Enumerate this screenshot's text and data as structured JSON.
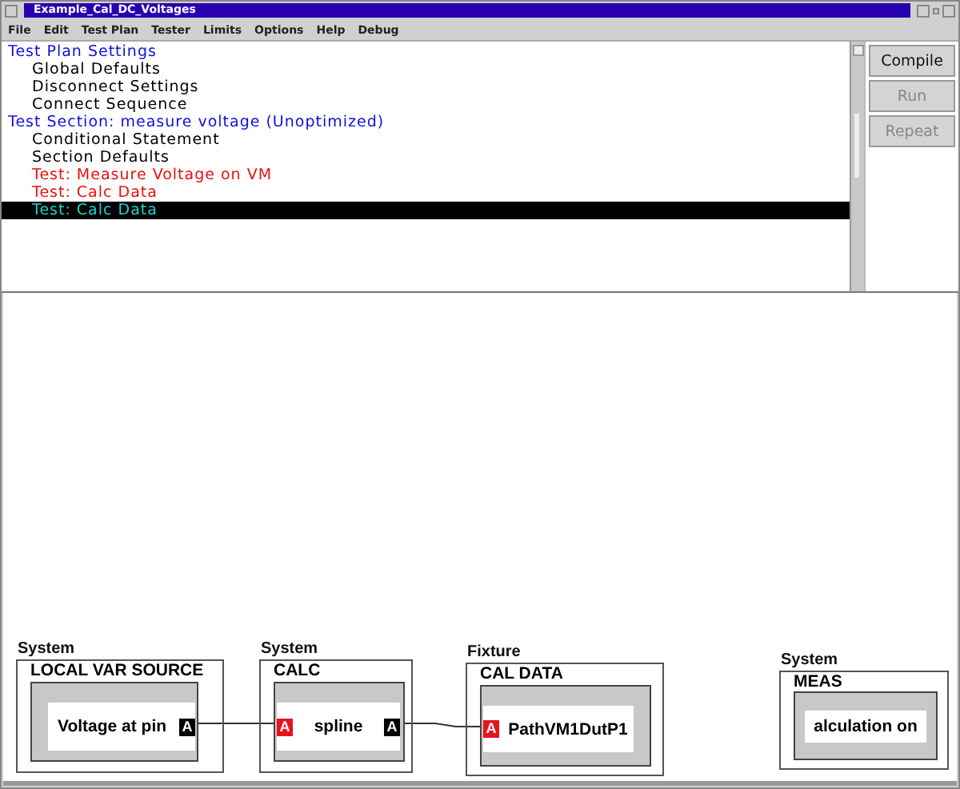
{
  "window": {
    "title": "Example_Cal_DC_Voltages"
  },
  "menu": [
    "File",
    "Edit",
    "Test Plan",
    "Tester",
    "Limits",
    "Options",
    "Help",
    "Debug"
  ],
  "tree": [
    {
      "label": "Test Plan Settings",
      "kind": "heading",
      "selected": false,
      "children": [
        {
          "label": "Global Defaults",
          "kind": "setting",
          "selected": false
        },
        {
          "label": "Disconnect Settings",
          "kind": "setting",
          "selected": false
        },
        {
          "label": "Connect Sequence",
          "kind": "setting",
          "selected": false
        }
      ]
    },
    {
      "label": "Test Section: measure voltage (Unoptimized)",
      "kind": "heading",
      "selected": false,
      "children": [
        {
          "label": "Conditional Statement",
          "kind": "setting",
          "selected": false
        },
        {
          "label": "Section Defaults",
          "kind": "setting",
          "selected": false
        },
        {
          "label": "Test: Measure Voltage on VM",
          "kind": "test",
          "selected": false
        },
        {
          "label": "Test: Calc Data",
          "kind": "test",
          "selected": false
        },
        {
          "label": "Test: Calc Data",
          "kind": "test",
          "selected": true
        }
      ]
    }
  ],
  "buttons": [
    {
      "label": "Compile",
      "disabled": false
    },
    {
      "label": "Run",
      "disabled": true
    },
    {
      "label": "Repeat",
      "disabled": true
    }
  ],
  "blocks": [
    {
      "group": "System",
      "title": "LOCAL VAR SOURCE",
      "label": "Voltage at pin",
      "right_port": {
        "label": "A",
        "color": "#000000"
      }
    },
    {
      "group": "System",
      "title": "CALC",
      "label": "spline",
      "left_port": {
        "label": "A",
        "color": "#e8141c"
      },
      "right_port": {
        "label": "A",
        "color": "#000000"
      }
    },
    {
      "group": "Fixture",
      "title": "CAL DATA",
      "label": "PathVM1DutP1",
      "left_port": {
        "label": "A",
        "color": "#e8141c"
      }
    },
    {
      "group": "System",
      "title": "MEAS",
      "label": "alculation on"
    }
  ]
}
